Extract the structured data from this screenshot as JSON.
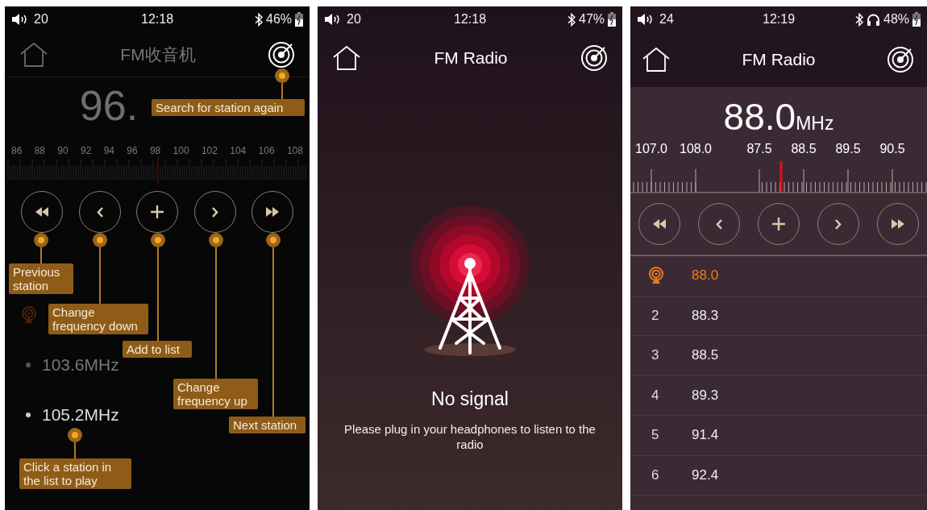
{
  "screens": [
    {
      "kind": "tutorial",
      "status_bar": {
        "volume": "20",
        "time": "12:18",
        "battery": "46%",
        "headphones": false
      },
      "header": {
        "title": "FM收音机"
      },
      "frequency": "96.",
      "scale_labels": [
        "86",
        "88",
        "90",
        "92",
        "94",
        "96",
        "98",
        "100",
        "102",
        "104",
        "106",
        "108"
      ],
      "stations": [
        {
          "playing": true,
          "highlighted": false
        },
        {
          "frequency": "103.6MHz",
          "playing": false,
          "highlighted": false
        },
        {
          "frequency": "105.2MHz",
          "playing": false,
          "highlighted": true
        }
      ],
      "callouts": [
        {
          "text": "Search for station again"
        },
        {
          "text": "Previous station"
        },
        {
          "text": "Change frequency down"
        },
        {
          "text": "Add to list"
        },
        {
          "text": "Change frequency up"
        },
        {
          "text": "Next station"
        },
        {
          "text": "Click a station in the list to play"
        }
      ]
    },
    {
      "kind": "no_signal",
      "status_bar": {
        "volume": "20",
        "time": "12:18",
        "battery": "47%",
        "headphones": false
      },
      "header": {
        "title": "FM Radio"
      },
      "message_title": "No signal",
      "message": "Please plug in your headphones to listen to the radio"
    },
    {
      "kind": "station_list",
      "status_bar": {
        "volume": "24",
        "time": "12:19",
        "battery": "48%",
        "headphones": true
      },
      "header": {
        "title": "FM Radio"
      },
      "frequency": "88.0",
      "unit": "MHz",
      "scale_labels": [
        "107.0",
        "108.0",
        "87.5",
        "88.5",
        "89.5",
        "90.5"
      ],
      "stations": [
        {
          "frequency": "88.0",
          "selected": true
        },
        {
          "number": "2",
          "frequency": "88.3",
          "selected": false
        },
        {
          "number": "3",
          "frequency": "88.5",
          "selected": false
        },
        {
          "number": "4",
          "frequency": "89.3",
          "selected": false
        },
        {
          "number": "5",
          "frequency": "91.4",
          "selected": false
        },
        {
          "number": "6",
          "frequency": "92.4",
          "selected": false
        }
      ]
    }
  ]
}
